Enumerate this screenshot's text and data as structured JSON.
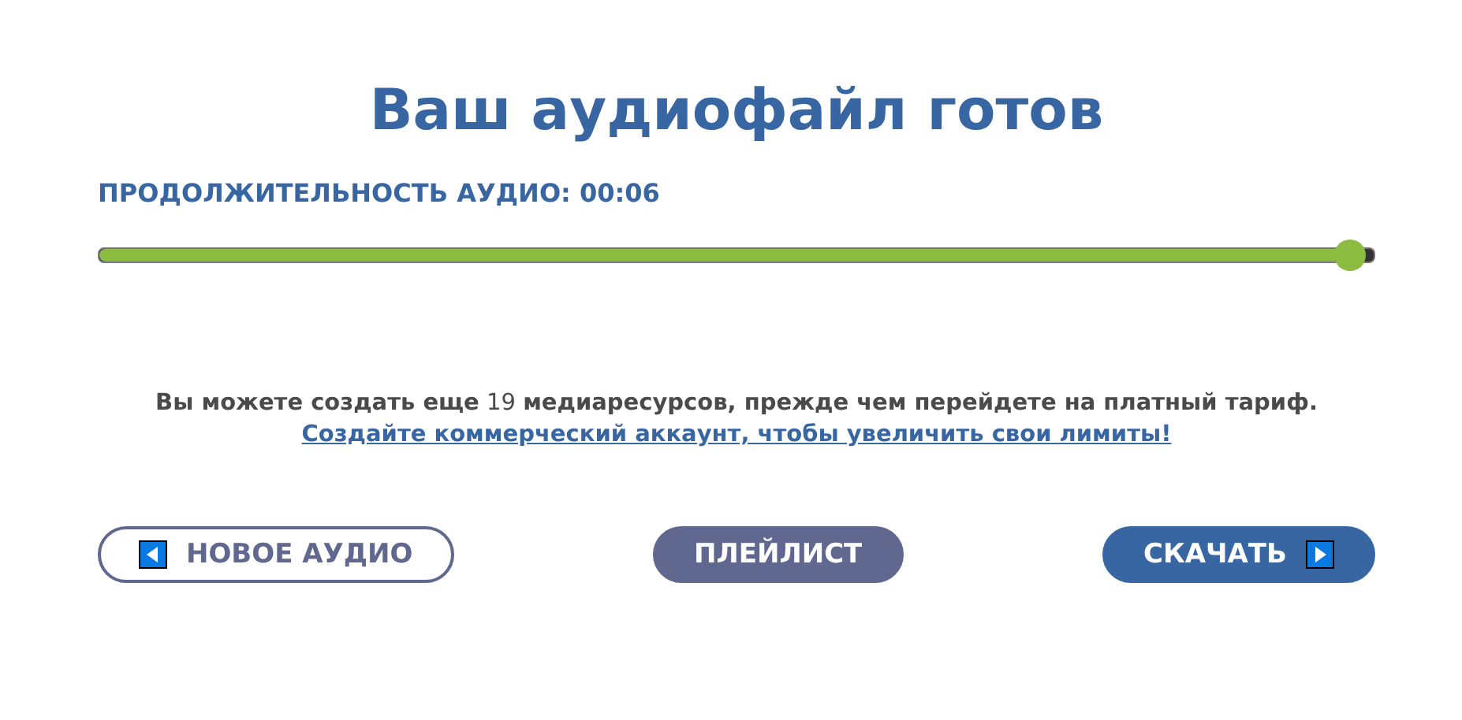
{
  "title": "Ваш аудиофайл готов",
  "duration": {
    "label": "ПРОДОЛЖИТЕЛЬНОСТЬ АУДИО: 00:06",
    "level": 0.98
  },
  "notice": {
    "text": "**Вы можете создать еще** 19 **медиаресурсов, прежде чем перейдете на платный тариф.**",
    "link": "Создайте коммерческий аккаунт, чтобы увеличить свои лимиты!"
  },
  "buttons": [
    {
      "label": "НОВОЕ АУДИО",
      "kind": "outline"
    },
    {
      "label": "ПЛЕЙЛИСТ",
      "kind": "secondary"
    },
    {
      "label": "СКАЧАТЬ",
      "kind": "primary"
    }
  ]
}
